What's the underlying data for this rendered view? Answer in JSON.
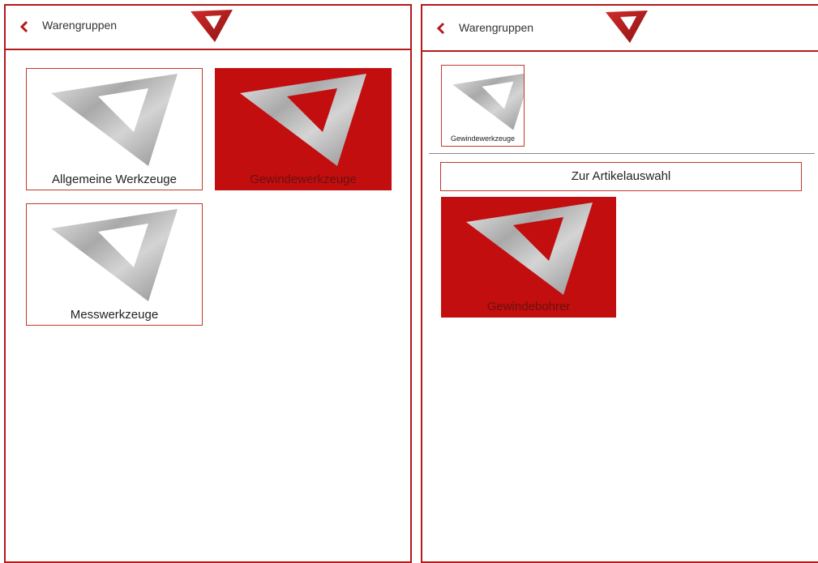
{
  "left_panel": {
    "header": {
      "back_icon": "chevron-left-icon",
      "title": "Warengruppen",
      "logo_icon": "red-triangle-logo-icon"
    },
    "tiles": [
      {
        "label": "Allgemeine Werkzeuge",
        "selected": false
      },
      {
        "label": "Gewindewerkzeuge",
        "selected": true
      },
      {
        "label": "Messwerkzeuge",
        "selected": false
      }
    ]
  },
  "right_panel": {
    "header": {
      "back_icon": "chevron-left-icon",
      "title": "Warengruppen",
      "logo_icon": "red-triangle-logo-icon"
    },
    "breadcrumb_tile": {
      "label": "Gewindewerkzeuge"
    },
    "article_button": {
      "label": "Zur Artikelauswahl"
    },
    "subgroup_tile": {
      "label": "Gewindebohrer",
      "selected": true
    }
  },
  "colors": {
    "accent": "#b31b1b",
    "selected_bg": "#c20e0e"
  }
}
